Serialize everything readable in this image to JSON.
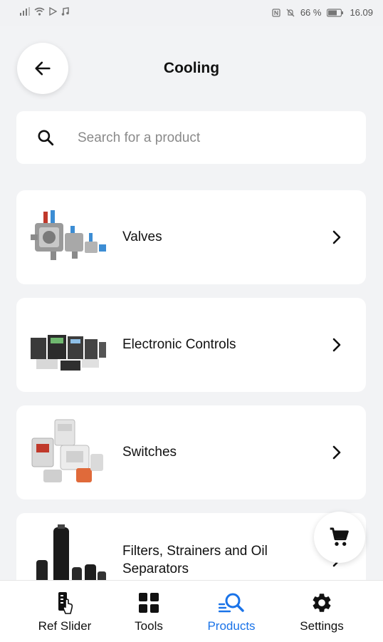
{
  "status_bar": {
    "battery": "66 %",
    "time": "16.09"
  },
  "header": {
    "title": "Cooling"
  },
  "search": {
    "placeholder": "Search for a product"
  },
  "categories": [
    {
      "label": "Valves"
    },
    {
      "label": "Electronic Controls"
    },
    {
      "label": "Switches"
    },
    {
      "label": "Filters, Strainers and Oil Separators"
    }
  ],
  "bottom_nav": {
    "items": [
      {
        "label": "Ref Slider",
        "icon": "ref-slider-icon"
      },
      {
        "label": "Tools",
        "icon": "grid-icon"
      },
      {
        "label": "Products",
        "icon": "product-search-icon",
        "active": true
      },
      {
        "label": "Settings",
        "icon": "gear-icon"
      }
    ]
  },
  "colors": {
    "background": "#f2f3f5",
    "active_nav": "#1a73e8",
    "card": "#ffffff"
  }
}
